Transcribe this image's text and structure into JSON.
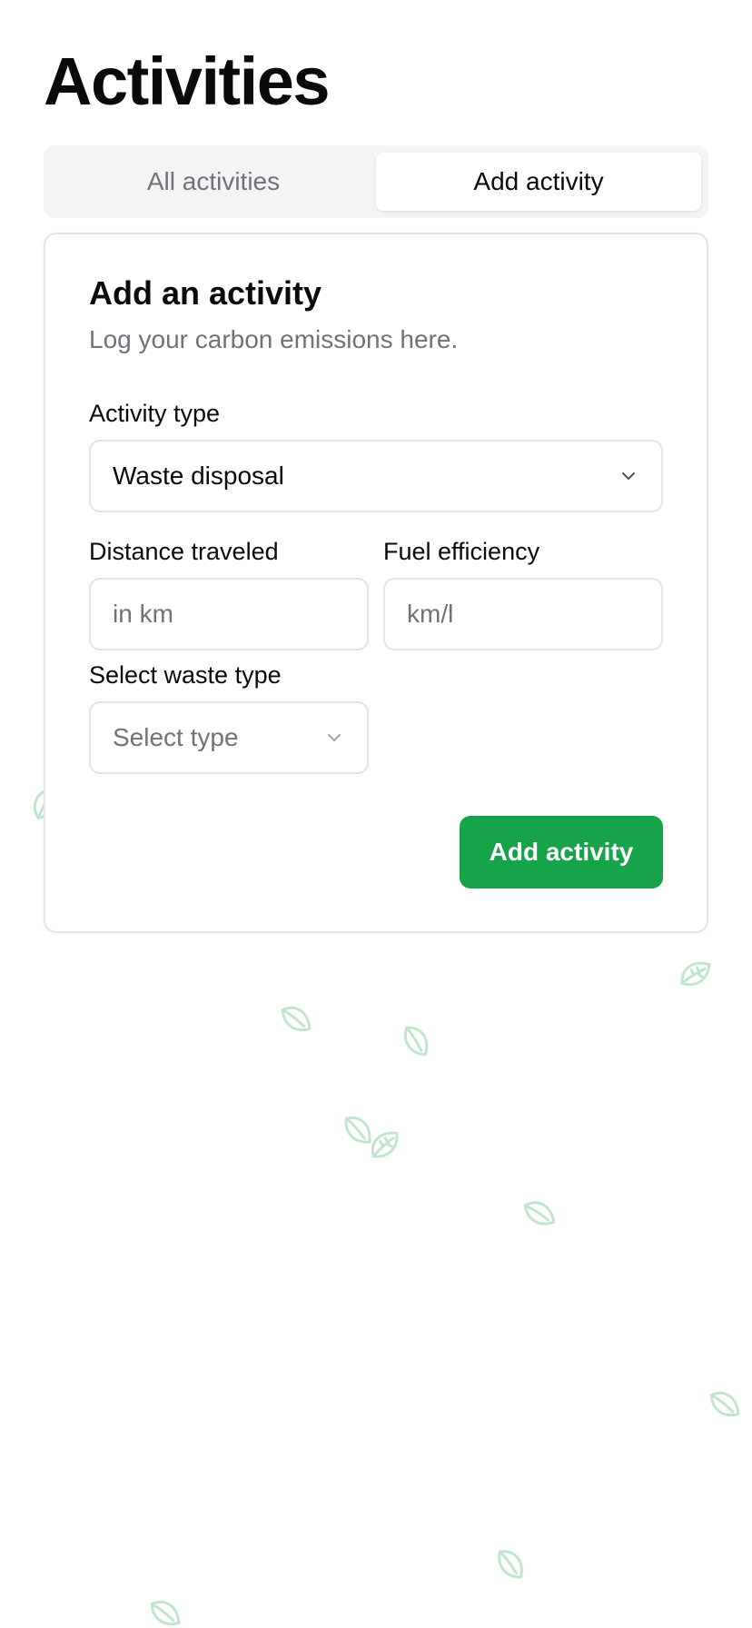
{
  "page": {
    "title": "Activities"
  },
  "tabs": [
    {
      "label": "All activities",
      "active": false
    },
    {
      "label": "Add activity",
      "active": true
    }
  ],
  "form": {
    "title": "Add an activity",
    "description": "Log your carbon emissions here.",
    "activity_type": {
      "label": "Activity type",
      "value": "Waste disposal"
    },
    "distance": {
      "label": "Distance traveled",
      "placeholder": "in km",
      "value": ""
    },
    "fuel_efficiency": {
      "label": "Fuel efficiency",
      "placeholder": "km/l",
      "value": ""
    },
    "waste_type": {
      "label": "Select waste type",
      "placeholder": "Select type"
    },
    "submit_label": "Add activity"
  },
  "colors": {
    "accent": "#16a34a",
    "leaf": "#bfe6cc",
    "muted_text": "#71717a",
    "border": "#e4e4e7",
    "tab_bg": "#f4f4f5"
  },
  "icons": {
    "dropdown": "chevron-down-icon",
    "decoration": "leaf-icon"
  }
}
